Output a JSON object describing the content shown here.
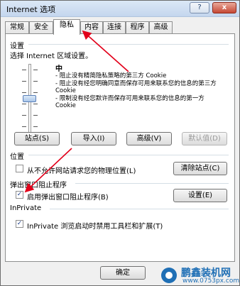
{
  "window": {
    "title": "Internet 选项",
    "help_label": "?",
    "close_label": "x"
  },
  "tabs": [
    "常规",
    "安全",
    "隐私",
    "内容",
    "连接",
    "程序",
    "高级"
  ],
  "active_tab": "隐私",
  "settings": {
    "group_label": "设置",
    "prompt": "选择 Internet 区域设置。",
    "slider_level": "中",
    "slider_value_percent": 50,
    "description": [
      "- 阻止没有精简隐私策略的第三方 Cookie",
      "- 阻止没有经您明确同意而保存可用来联系您的信息的第三方 Cookie",
      "- 限制没有经您默许而保存可用来联系您的信息的第一方 Cookie"
    ],
    "buttons": {
      "sites": "站点(S)",
      "import": "导入(I)",
      "advanced": "高级(V)",
      "default": "默认值(D)"
    }
  },
  "location": {
    "group_label": "位置",
    "checkbox_label": "从不允许网站请求您的物理位置(L)",
    "checked": false,
    "clear_button": "清除站点(C)"
  },
  "popup": {
    "group_label": "弹出窗口阻止程序",
    "checkbox_label": "启用弹出窗口阻止程序(B)",
    "checked": true,
    "settings_button": "设置(E)"
  },
  "inprivate": {
    "group_label": "InPrivate",
    "checkbox_label": "InPrivate 浏览启动时禁用工具栏和扩展(T)",
    "checked": true
  },
  "footer": {
    "ok_label": "确定"
  },
  "watermark": {
    "text": "鹏鑫装机网",
    "url": "www.0753px.com"
  },
  "colors": {
    "annotation_arrow": "#e2001a",
    "panel_bg": "#ffffff",
    "dialog_bg": "#f0f0f0"
  }
}
